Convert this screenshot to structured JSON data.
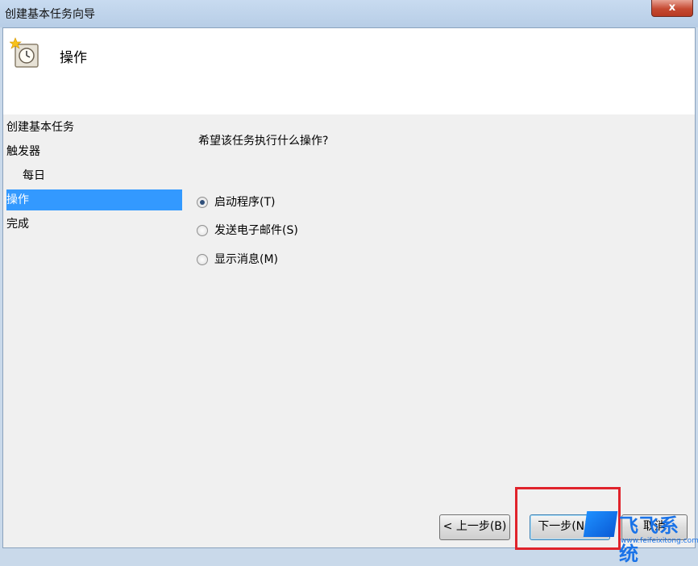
{
  "window": {
    "title": "创建基本任务向导",
    "close_label": "x"
  },
  "header": {
    "title": "操作",
    "icon": "scheduled-task-clock-icon"
  },
  "nav": {
    "items": [
      {
        "label": "创建基本任务",
        "selected": false
      },
      {
        "label": "触发器",
        "selected": false
      },
      {
        "label": "每日",
        "selected": false
      },
      {
        "label": "操作",
        "selected": true
      },
      {
        "label": "完成",
        "selected": false
      }
    ]
  },
  "content": {
    "question": "希望该任务执行什么操作?",
    "options": [
      {
        "label": "启动程序(T)",
        "checked": true
      },
      {
        "label": "发送电子邮件(S)",
        "checked": false
      },
      {
        "label": "显示消息(M)",
        "checked": false
      }
    ]
  },
  "buttons": {
    "back": "< 上一步(B)",
    "next": "下一步(N) >",
    "cancel": "取消"
  },
  "watermark": {
    "brand": "飞飞系统",
    "url": "www.feifeixitong.com"
  },
  "colors": {
    "selection": "#3399ff",
    "highlight_box": "#e0232b",
    "titlebar": "#c8dbf0"
  }
}
